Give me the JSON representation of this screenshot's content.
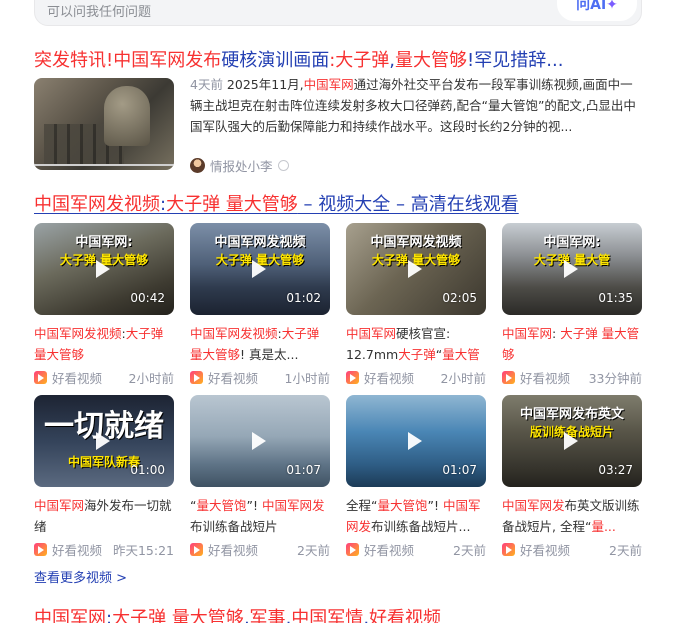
{
  "search": {
    "placeholder": "可以问我任何问题",
    "ai_label": "问AI",
    "ai_spark": "✦"
  },
  "result1": {
    "title_segments": [
      {
        "t": "突发特讯!",
        "hl": true
      },
      {
        "t": "中国军网发布",
        "hl": true
      },
      {
        "t": "硬核演训画面",
        "hl": false
      },
      {
        "t": ":大子弹",
        "hl": true
      },
      {
        "t": ",",
        "hl": false
      },
      {
        "t": "量大管够",
        "hl": true
      },
      {
        "t": "!罕见措辞...",
        "hl": false
      }
    ],
    "when": "4天前",
    "body_pre": " 2025年11月,",
    "body_hl": "中国军网",
    "body_post": "通过海外社交平台发布一段军事训练视频,画面中一辆主战坦克在射击阵位连续发射多枚大口径弹药,配合“量大管饱”的配文,凸显出中国军队强大的后勤保障能力和持续作战水平。这段时长约2分钟的视...",
    "source": "情报处小李"
  },
  "video_section": {
    "title_segments": [
      {
        "t": "中国军网发视频",
        "hl": true
      },
      {
        "t": ":",
        "hl": false
      },
      {
        "t": "大子弹 量大管够",
        "hl": true
      },
      {
        "t": " – 视频大全 – 高清在线观看",
        "hl": false
      }
    ],
    "cards": [
      {
        "duration": "00:42",
        "title": [
          {
            "t": "中国军网发视频",
            "hl": true
          },
          {
            "t": ":",
            "hl": false
          },
          {
            "t": "大子弹 量大管够",
            "hl": true
          }
        ],
        "source": "好看视频",
        "time": "2小时前",
        "caption_top": "中国军网:",
        "caption_bottom": "大子弹 量大管够",
        "bg": "army"
      },
      {
        "duration": "01:02",
        "title": [
          {
            "t": "中国军网发视频",
            "hl": true
          },
          {
            "t": ":",
            "hl": false
          },
          {
            "t": "大子弹量大管够",
            "hl": true
          },
          {
            "t": "! 真是太...",
            "hl": false
          }
        ],
        "source": "好看视频",
        "time": "1小时前",
        "caption_top": "中国军网发视频",
        "caption_bottom": "大子弹 量大管够",
        "bg": "ship"
      },
      {
        "duration": "02:05",
        "title": [
          {
            "t": "中国军网",
            "hl": true
          },
          {
            "t": "硬核官宣: 12.7mm",
            "hl": false
          },
          {
            "t": "大子弹",
            "hl": true
          },
          {
            "t": "“",
            "hl": false
          },
          {
            "t": "量大管够",
            "hl": true
          },
          {
            "t": "”",
            "hl": false
          }
        ],
        "source": "好看视频",
        "time": "2小时前",
        "caption_top": "中国军网发视频",
        "caption_bottom": "大子弹 量大管够",
        "bg": "soldier"
      },
      {
        "duration": "01:35",
        "title": [
          {
            "t": "中国军网",
            "hl": true
          },
          {
            "t": ": ",
            "hl": false
          },
          {
            "t": "大子弹 量大管够",
            "hl": true
          }
        ],
        "source": "好看视频",
        "time": "33分钟前",
        "caption_top": "中国军网:",
        "caption_bottom": "大子弹 量大管",
        "bg": "rocket"
      },
      {
        "duration": "01:00",
        "title": [
          {
            "t": "中国军网",
            "hl": true
          },
          {
            "t": "海外发布一切就绪",
            "hl": false
          }
        ],
        "source": "好看视频",
        "time": "昨天15:21",
        "caption_top": "一切就绪",
        "caption_bottom": "中国军队新春",
        "bg": "ready"
      },
      {
        "duration": "01:07",
        "title": [
          {
            "t": "“",
            "hl": false
          },
          {
            "t": "量大管饱",
            "hl": true
          },
          {
            "t": "”! ",
            "hl": false
          },
          {
            "t": "中国军网发",
            "hl": true
          },
          {
            "t": "布训练备战短片",
            "hl": false
          }
        ],
        "source": "好看视频",
        "time": "2天前",
        "caption_top": "",
        "caption_bottom": "",
        "bg": "sea"
      },
      {
        "duration": "01:07",
        "title": [
          {
            "t": "全程“",
            "hl": false
          },
          {
            "t": "量大管饱",
            "hl": true
          },
          {
            "t": "”! ",
            "hl": false
          },
          {
            "t": "中国军网发",
            "hl": true
          },
          {
            "t": "布训练备战短片...",
            "hl": false
          }
        ],
        "source": "好看视频",
        "time": "2天前",
        "caption_top": "",
        "caption_bottom": "",
        "bg": "deck"
      },
      {
        "duration": "03:27",
        "title": [
          {
            "t": "中国军网发",
            "hl": true
          },
          {
            "t": "布英文版训练备战短片, 全程“",
            "hl": false
          },
          {
            "t": "量...",
            "hl": true
          }
        ],
        "source": "好看视频",
        "time": "2天前",
        "caption_top": "中国军网发布英文",
        "caption_bottom": "版训练备战短片",
        "bg": "troops"
      }
    ],
    "more_label": "查看更多视频 >"
  },
  "result3": {
    "title_segments": [
      {
        "t": "中国军网",
        "hl": true
      },
      {
        "t": ":",
        "hl": false
      },
      {
        "t": "大子弹 量大管够",
        "hl": true
      },
      {
        "t": ",",
        "hl": false
      },
      {
        "t": "军事",
        "hl": true
      },
      {
        "t": ",",
        "hl": false
      },
      {
        "t": "中国军情",
        "hl": true
      },
      {
        "t": ",",
        "hl": false
      },
      {
        "t": "好看视频",
        "hl": true
      }
    ]
  },
  "colors": {
    "link": "#2440b3",
    "highlight": "#f73131",
    "meta": "#9195a3",
    "ai": "#4e6ef2"
  },
  "icons": [
    "play-icon",
    "haokan-icon",
    "verified-icon",
    "ai-spark-icon"
  ]
}
